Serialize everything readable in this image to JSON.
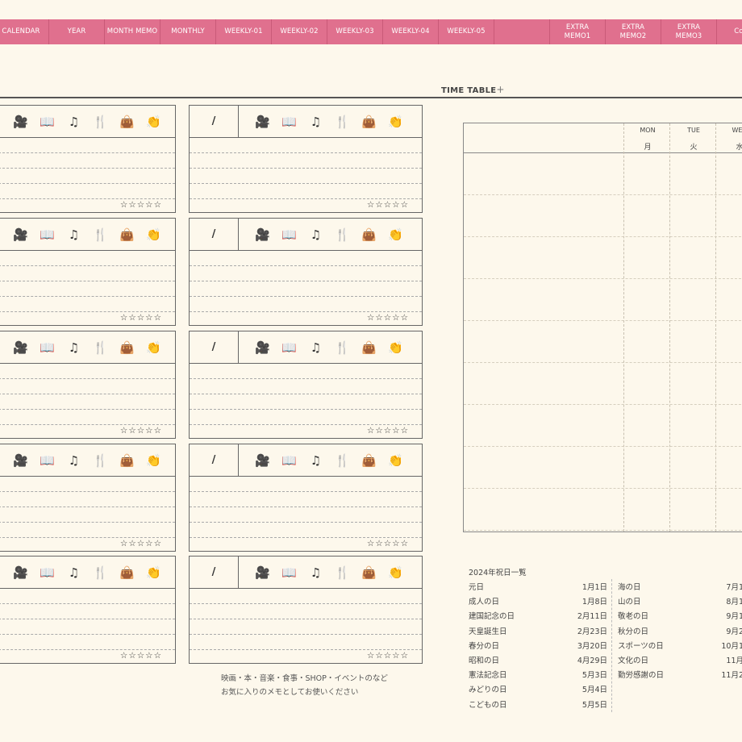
{
  "nav": {
    "tabs": [
      "CALENDAR",
      "YEAR",
      "MONTH MEMO",
      "MONTHLY",
      "WEEKLY-01",
      "WEEKLY-02",
      "WEEKLY-03",
      "WEEKLY-04",
      "WEEKLY-05",
      "",
      "EXTRA\nMEMO1",
      "EXTRA\nMEMO2",
      "EXTRA\nMEMO3",
      "Conte"
    ]
  },
  "timetable": {
    "title": "TIME TABLE",
    "plus": "+",
    "days_en": [
      "MON",
      "TUE",
      "WED"
    ],
    "days_jp": [
      "月",
      "火",
      "水"
    ]
  },
  "cards": {
    "date_slash": "/",
    "stars": "☆☆☆☆☆",
    "icons": [
      "movie-camera-icon",
      "book-icon",
      "music-note-icon",
      "fork-knife-icon",
      "bag-icon",
      "clapping-hands-icon"
    ]
  },
  "note": {
    "line1": "映画・本・音楽・食事・SHOP・イベントのなど",
    "line2": "お気に入りのメモとしてお使いください"
  },
  "holidays": {
    "title": "2024年祝日一覧",
    "left": [
      {
        "name": "元日",
        "date": "1月1日"
      },
      {
        "name": "成人の日",
        "date": "1月8日"
      },
      {
        "name": "建国記念の日",
        "date": "2月11日"
      },
      {
        "name": "天皇誕生日",
        "date": "2月23日"
      },
      {
        "name": "春分の日",
        "date": "3月20日"
      },
      {
        "name": "昭和の日",
        "date": "4月29日"
      },
      {
        "name": "憲法記念日",
        "date": "5月3日"
      },
      {
        "name": "みどりの日",
        "date": "5月4日"
      },
      {
        "name": "こどもの日",
        "date": "5月5日"
      }
    ],
    "right": [
      {
        "name": "海の日",
        "date": "7月1"
      },
      {
        "name": "山の日",
        "date": "8月1"
      },
      {
        "name": "敬老の日",
        "date": "9月1"
      },
      {
        "name": "秋分の日",
        "date": "9月2"
      },
      {
        "name": "スポーツの日",
        "date": "10月1"
      },
      {
        "name": "文化の日",
        "date": "11月"
      },
      {
        "name": "勤労感謝の日",
        "date": "11月2"
      }
    ]
  }
}
